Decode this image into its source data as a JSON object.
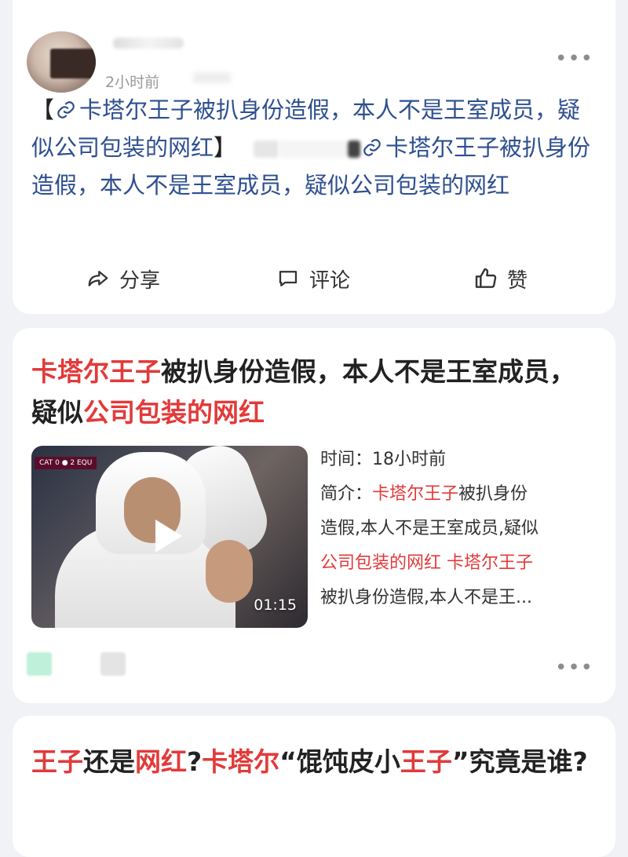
{
  "post1": {
    "time": "2小时前",
    "text_open": "【",
    "text_link1": "卡塔尔王子被扒身份造假，本人不是王室成员，疑似公司包装的网红",
    "text_close": "】",
    "text_link2": "卡塔尔王子被扒身份造假，本人不是王室成员，疑似公司包装的网红",
    "more_icon": "more-dots-icon",
    "actions": {
      "share": "分享",
      "comment": "评论",
      "like": "赞"
    },
    "link_color": "#2e4f8f"
  },
  "post2": {
    "title_parts": [
      {
        "text": "卡塔尔王子",
        "hl": true
      },
      {
        "text": "被扒身份造假，本人不是王室成",
        "hl": false
      },
      {
        "text": "员，疑似",
        "hl": false
      },
      {
        "text": "公司包装的网红",
        "hl": true
      }
    ],
    "video": {
      "scoreboard": "CAT 0 ● 2 EQU",
      "duration": "01:15"
    },
    "meta": {
      "time_label": "时间：",
      "time_value": "18小时前",
      "intro_label": "简介：",
      "intro_hl1": "卡塔尔王子",
      "intro_rest1": "被扒身份",
      "intro_line2": "造假,本人不是王室成员,疑似",
      "intro_hl2": "公司包装的网红 卡塔尔王子",
      "intro_line4": "被扒身份造假,本人不是王..."
    },
    "highlight_color": "#e23a3a"
  },
  "post3": {
    "title_parts": [
      {
        "text": "王子",
        "hl": true
      },
      {
        "text": "还是",
        "hl": false
      },
      {
        "text": "网红",
        "hl": true
      },
      {
        "text": "?",
        "hl": false
      },
      {
        "text": "卡塔尔",
        "hl": true
      },
      {
        "text": "“馄饨皮小",
        "hl": false
      },
      {
        "text": "王子",
        "hl": true
      },
      {
        "text": "”究竟是谁?",
        "hl": false
      }
    ]
  }
}
